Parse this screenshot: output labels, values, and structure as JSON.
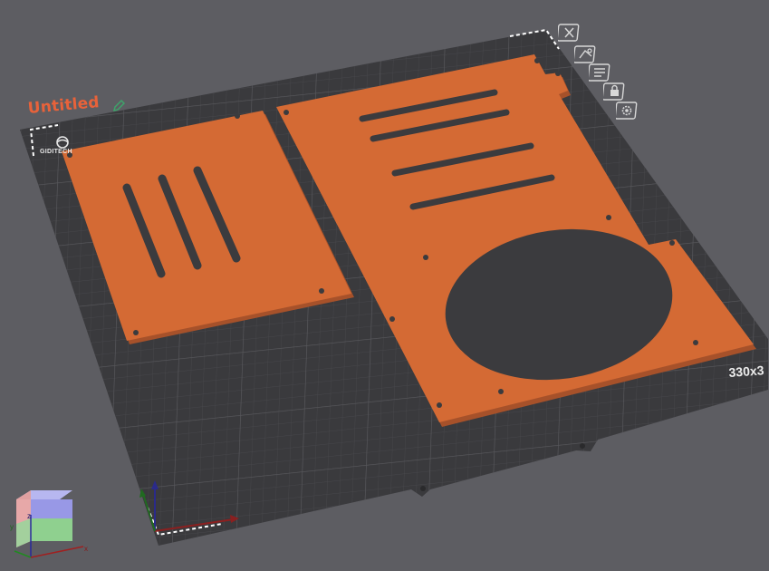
{
  "plate": {
    "name": "Untitled",
    "size_label": "330x3",
    "brand": "GIDITECH"
  },
  "tools": {
    "icons": [
      "close-icon",
      "plate-settings-icon",
      "arrange-icon",
      "lock-icon",
      "settings-gear-icon"
    ]
  },
  "view_cube": {
    "axis_x": "x",
    "axis_y": "y",
    "axis_z": "z"
  },
  "colors": {
    "background": "#5d5d62",
    "plate": "#3a3a3d",
    "part": "#d46a34",
    "title": "#e8623a"
  }
}
